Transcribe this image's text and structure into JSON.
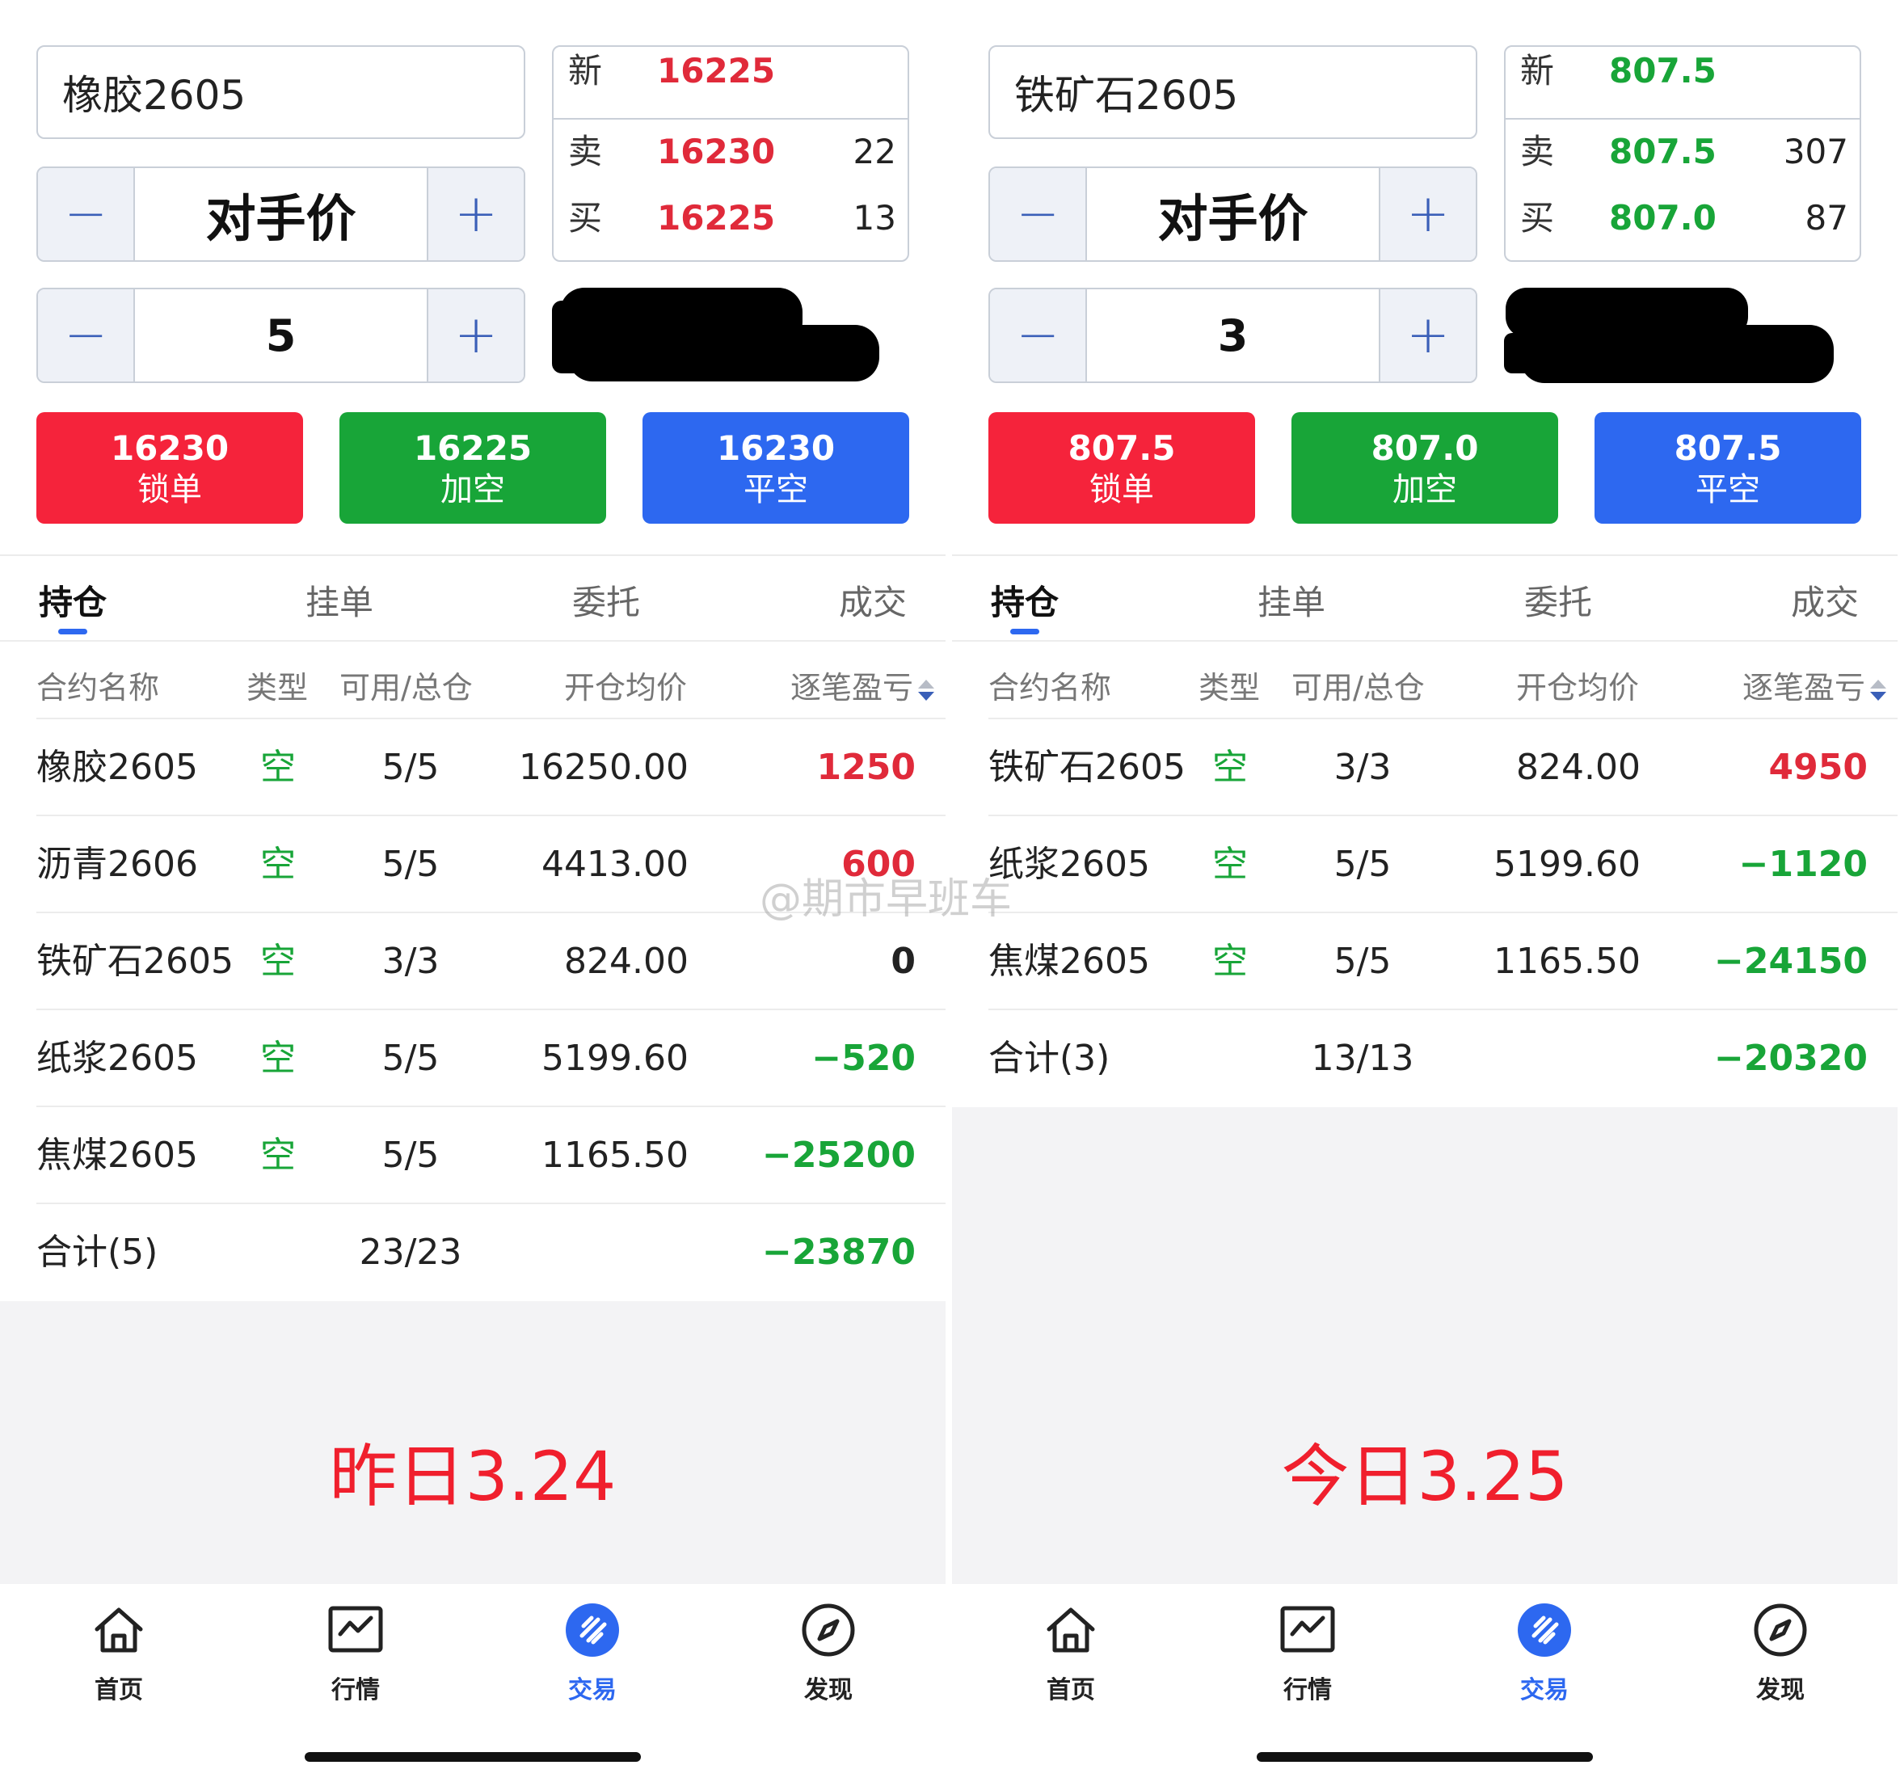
{
  "left": {
    "contract": "橡胶2605",
    "quote": {
      "new_label": "新",
      "new_price": "16225",
      "sell_label": "卖",
      "sell_price": "16230",
      "sell_vol": "22",
      "buy_label": "买",
      "buy_price": "16225",
      "buy_vol": "13",
      "price_color": "#e02a3a"
    },
    "price_mode": "对手价",
    "quantity": "5",
    "buttons": [
      {
        "price": "16230",
        "label": "锁单",
        "color": "#f5233b"
      },
      {
        "price": "16225",
        "label": "加空",
        "color": "#18a538"
      },
      {
        "price": "16230",
        "label": "平空",
        "color": "#2d68f0"
      }
    ],
    "tabs": [
      "持仓",
      "挂单",
      "委托",
      "成交"
    ],
    "columns": [
      "合约名称",
      "类型",
      "可用/总仓",
      "开仓均价",
      "逐笔盈亏"
    ],
    "positions": [
      {
        "name": "橡胶2605",
        "type": "空",
        "qty": "5/5",
        "price": "16250.00",
        "pnl": "1250",
        "pnl_color": "red"
      },
      {
        "name": "沥青2606",
        "type": "空",
        "qty": "5/5",
        "price": "4413.00",
        "pnl": "600",
        "pnl_color": "red"
      },
      {
        "name": "铁矿石2605",
        "type": "空",
        "qty": "3/3",
        "price": "824.00",
        "pnl": "0",
        "pnl_color": "black"
      },
      {
        "name": "纸浆2605",
        "type": "空",
        "qty": "5/5",
        "price": "5199.60",
        "pnl": "−520",
        "pnl_color": "green"
      },
      {
        "name": "焦煤2605",
        "type": "空",
        "qty": "5/5",
        "price": "1165.50",
        "pnl": "−25200",
        "pnl_color": "green"
      }
    ],
    "total": {
      "label": "合计(5)",
      "qty": "23/23",
      "pnl": "−23870"
    },
    "day_label": "昨日3.24"
  },
  "right": {
    "contract": "铁矿石2605",
    "quote": {
      "new_label": "新",
      "new_price": "807.5",
      "sell_label": "卖",
      "sell_price": "807.5",
      "sell_vol": "307",
      "buy_label": "买",
      "buy_price": "807.0",
      "buy_vol": "87",
      "price_color": "#18a538"
    },
    "price_mode": "对手价",
    "quantity": "3",
    "buttons": [
      {
        "price": "807.5",
        "label": "锁单",
        "color": "#f5233b"
      },
      {
        "price": "807.0",
        "label": "加空",
        "color": "#18a538"
      },
      {
        "price": "807.5",
        "label": "平空",
        "color": "#2d68f0"
      }
    ],
    "tabs": [
      "持仓",
      "挂单",
      "委托",
      "成交"
    ],
    "columns": [
      "合约名称",
      "类型",
      "可用/总仓",
      "开仓均价",
      "逐笔盈亏"
    ],
    "positions": [
      {
        "name": "铁矿石2605",
        "type": "空",
        "qty": "3/3",
        "price": "824.00",
        "pnl": "4950",
        "pnl_color": "red"
      },
      {
        "name": "纸浆2605",
        "type": "空",
        "qty": "5/5",
        "price": "5199.60",
        "pnl": "−1120",
        "pnl_color": "green"
      },
      {
        "name": "焦煤2605",
        "type": "空",
        "qty": "5/5",
        "price": "1165.50",
        "pnl": "−24150",
        "pnl_color": "green"
      }
    ],
    "total": {
      "label": "合计(3)",
      "qty": "13/13",
      "pnl": "−20320"
    },
    "day_label": "今日3.25"
  },
  "nav": [
    {
      "label": "首页",
      "icon": "home-icon"
    },
    {
      "label": "行情",
      "icon": "market-chart-icon"
    },
    {
      "label": "交易",
      "icon": "trade-icon",
      "active": true
    },
    {
      "label": "发现",
      "icon": "compass-icon"
    }
  ],
  "watermark": "@期市早班车"
}
